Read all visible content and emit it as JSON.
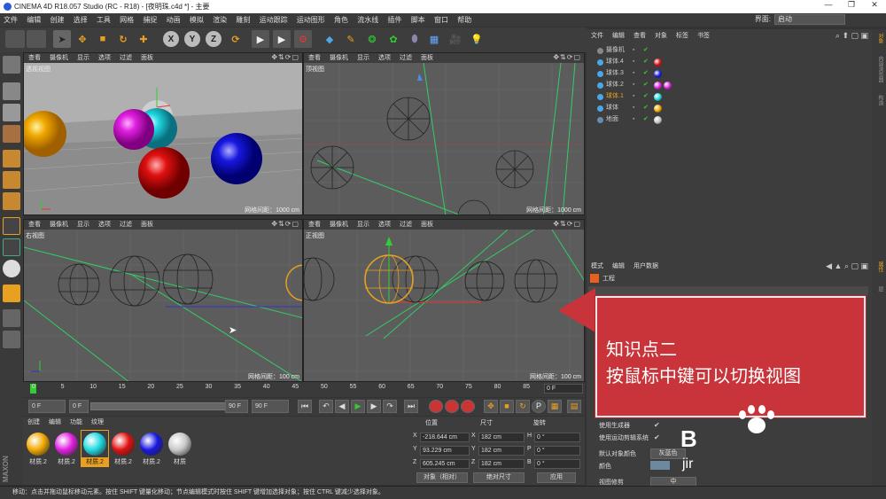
{
  "window": {
    "title": "CINEMA 4D R18.057 Studio (RC - R18) - [夜明珠.c4d *] - 主要",
    "controls": [
      "—",
      "❐",
      "✕"
    ]
  },
  "menubar": {
    "items": [
      "文件",
      "编辑",
      "创建",
      "选择",
      "工具",
      "网格",
      "捕捉",
      "动画",
      "模拟",
      "渲染",
      "雕刻",
      "运动跟踪",
      "运动图形",
      "角色",
      "流水线",
      "插件",
      "脚本",
      "窗口",
      "帮助"
    ],
    "layout_label": "界面:",
    "layout_value": "启动"
  },
  "toolbar": {
    "axes": [
      "X",
      "Y",
      "Z"
    ]
  },
  "viewports": [
    {
      "menu": [
        "查看",
        "摄像机",
        "显示",
        "选项",
        "过滤",
        "面板"
      ],
      "name": "透视视图",
      "grid": ""
    },
    {
      "menu": [
        "查看",
        "摄像机",
        "显示",
        "选项",
        "过滤",
        "面板"
      ],
      "name": "顶视图",
      "grid": "网格间距：1000 cm"
    },
    {
      "menu": [
        "查看",
        "摄像机",
        "显示",
        "选项",
        "过滤",
        "面板"
      ],
      "name": "右视图",
      "grid": "网格间距：100 cm"
    },
    {
      "menu": [
        "查看",
        "摄像机",
        "显示",
        "选项",
        "过滤",
        "面板"
      ],
      "name": "正视图",
      "grid": "网格间距：100 cm"
    }
  ],
  "viewport0_grid": "网格间距：1000 cm",
  "viewport1_grid": "网格间距：100 cm",
  "timeline": {
    "ticks": [
      "0",
      "5",
      "10",
      "15",
      "20",
      "25",
      "30",
      "35",
      "40",
      "45",
      "50",
      "55",
      "60",
      "65",
      "70",
      "75",
      "80",
      "85",
      "90"
    ],
    "end_field": "0 F"
  },
  "playback": {
    "current": "0 F",
    "start": "0 F",
    "end": "90 F",
    "max": "90 F"
  },
  "materials": {
    "tabs": [
      "创建",
      "编辑",
      "功能",
      "纹理"
    ],
    "items": [
      {
        "label": "材质.2",
        "color": "#f0a800"
      },
      {
        "label": "材质.2",
        "color": "#e020e0"
      },
      {
        "label": "材质.2",
        "color": "#20d8e0"
      },
      {
        "label": "材质.2",
        "color": "#e01010"
      },
      {
        "label": "材质.2",
        "color": "#1818e0"
      },
      {
        "label": "材质",
        "color": "#c8c8c8"
      }
    ]
  },
  "coordinates": {
    "headers": [
      "位置",
      "尺寸",
      "旋转"
    ],
    "rows": [
      {
        "axis": "X",
        "pos": "-218.644 cm",
        "size": "182 cm",
        "rl": "H",
        "rot": "0 °"
      },
      {
        "axis": "Y",
        "pos": "93.229 cm",
        "size": "182 cm",
        "rl": "P",
        "rot": "0 °"
      },
      {
        "axis": "Z",
        "pos": "605.245 cm",
        "size": "182 cm",
        "rl": "B",
        "rot": "0 °"
      }
    ],
    "mode": "对象（相对）",
    "size_mode": "绝对尺寸",
    "apply": "应用"
  },
  "objects": {
    "menu": [
      "文件",
      "编辑",
      "查看",
      "对象",
      "标签",
      "书签"
    ],
    "rows": [
      {
        "name": "摄像机",
        "tags": []
      },
      {
        "name": "球体.4",
        "tags": [
          "#e01010"
        ]
      },
      {
        "name": "球体.3",
        "tags": [
          "#1818e0"
        ]
      },
      {
        "name": "球体.2",
        "tags": [
          "#e020e0",
          "#e020e0"
        ]
      },
      {
        "name": "球体.1",
        "tags": [
          "#20d8e0"
        ]
      },
      {
        "name": "球体",
        "tags": [
          "#f0a800"
        ]
      },
      {
        "name": "地面",
        "tags": [
          "#c8c8c8"
        ]
      }
    ]
  },
  "attributes": {
    "menu": [
      "模式",
      "编辑",
      "用户数据"
    ],
    "title": "工程",
    "rows": [
      "使用生成器",
      "使用运动剪辑系统",
      "默认对象颜色",
      "颜色",
      "视图修剪"
    ],
    "default_color_value": "灰蓝色",
    "clip_value": "中"
  },
  "right_tabs": [
    "对象",
    "内容浏览器",
    "构造",
    "属性",
    "层"
  ],
  "status": "移动：点击并拖动鼠标移动元素。按住 SHIFT 键量化移动；节点编辑模式时按住 SHIFT 键增加选择对象；按住 CTRL 键减少选择对象。",
  "callout": {
    "line1": "知识点二",
    "line2": "按鼠标中键可以切换视图"
  },
  "watermark": {
    "big": "B",
    "small": "jir"
  }
}
